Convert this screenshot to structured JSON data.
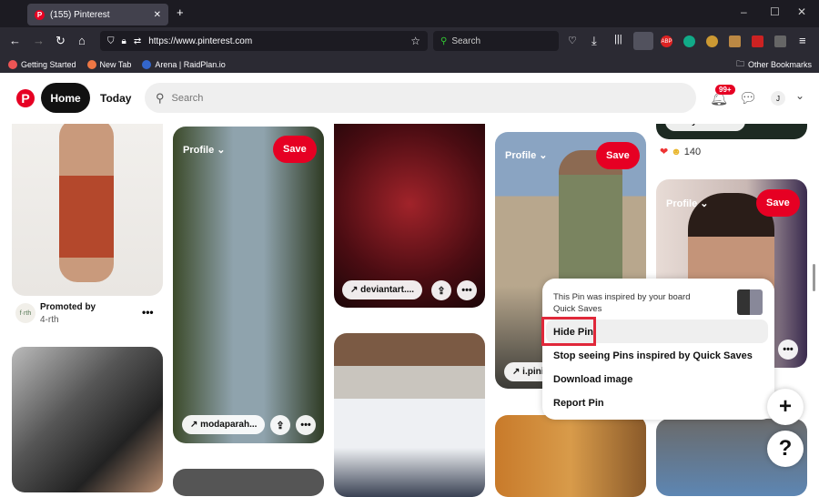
{
  "browser": {
    "tab_title": "(155) Pinterest",
    "url": "https://www.pinterest.com",
    "search_placeholder": "Search",
    "bookmarks": [
      "Getting Started",
      "New Tab",
      "Arena | RaidPlan.io"
    ],
    "other_bookmarks": "Other Bookmarks",
    "ext_abp": "ABP"
  },
  "header": {
    "home": "Home",
    "today": "Today",
    "search_placeholder": "Search",
    "notifications_badge": "99+",
    "avatar": "J"
  },
  "pins": {
    "profile": "Profile",
    "save": "Save",
    "promoted_label": "Promoted by",
    "promoted_by": "4-rth",
    "link_modaparah": "modaparah...",
    "link_deviantart": "deviantart....",
    "link_ipini": "i.pini",
    "link_myoutube": "myoutube....",
    "reactions_count": "140"
  },
  "menu": {
    "inspired_text": "This Pin was inspired by your board",
    "board": "Quick Saves",
    "items": [
      "Hide Pin",
      "Stop seeing Pins inspired by Quick Saves",
      "Download image",
      "Report Pin"
    ]
  },
  "fab": {
    "add": "+",
    "help": "?"
  }
}
